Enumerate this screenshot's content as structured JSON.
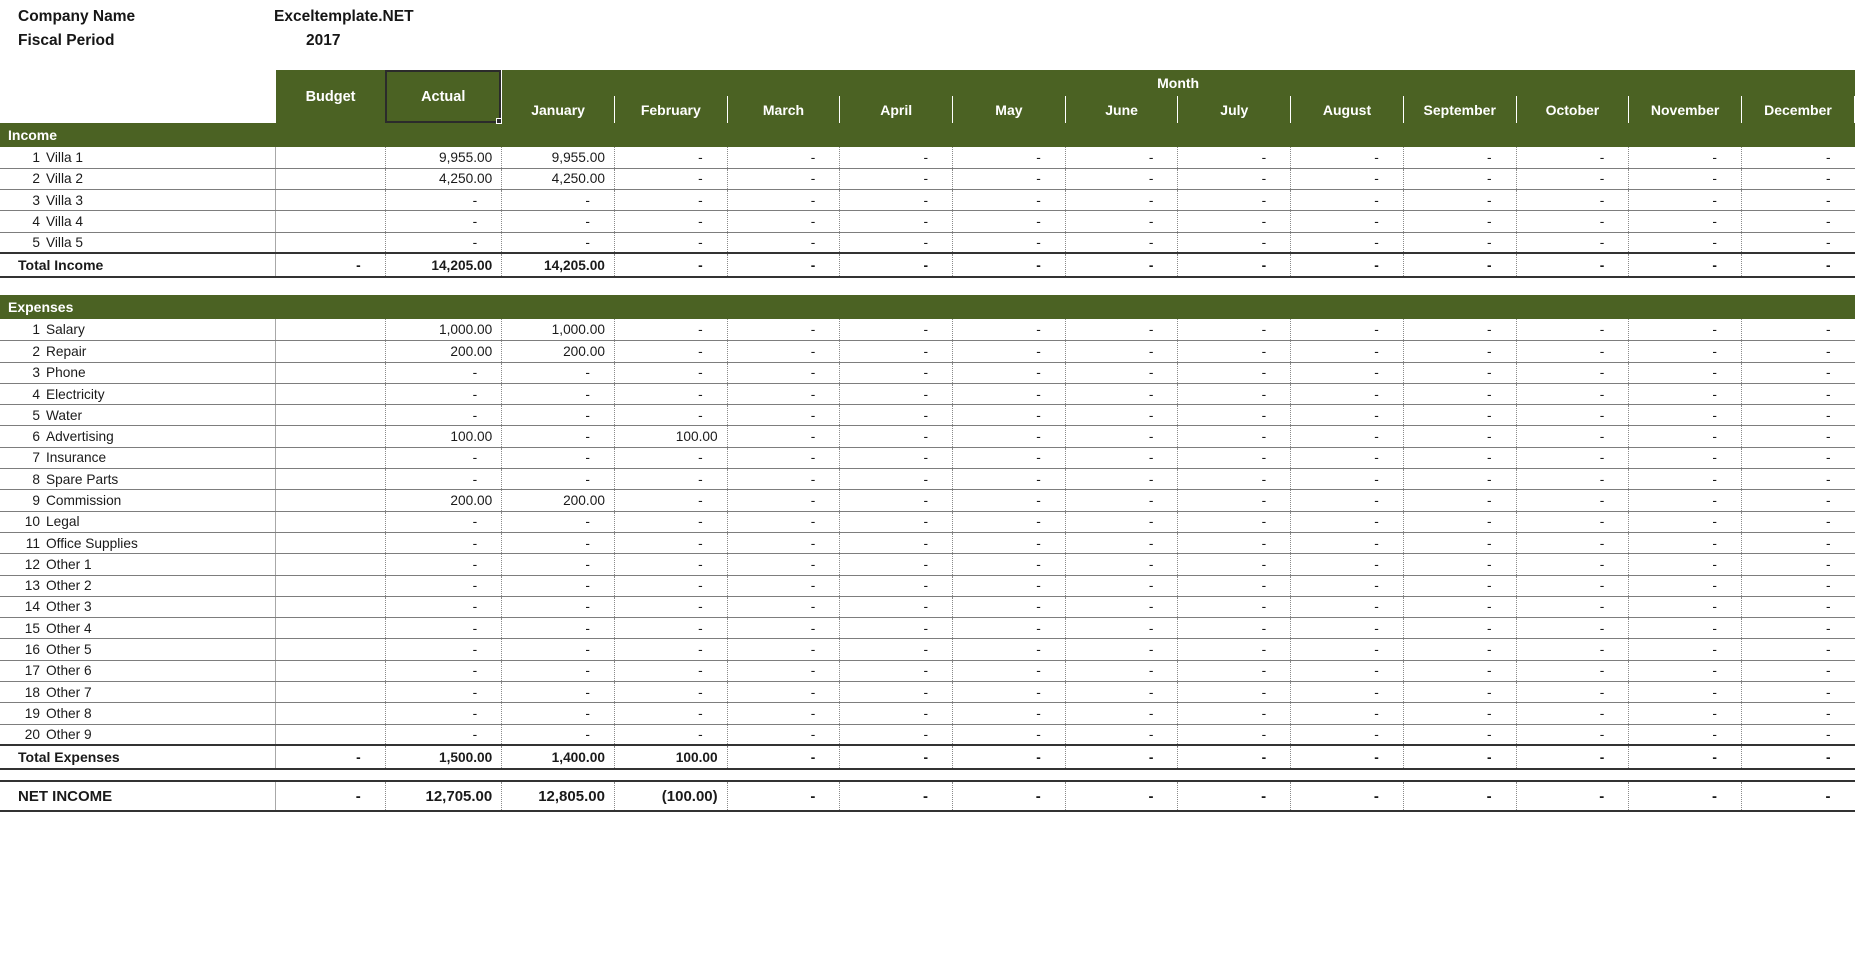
{
  "meta": {
    "company_label": "Company Name",
    "company_value": "Exceltemplate.NET",
    "fiscal_label": "Fiscal Period",
    "fiscal_value": "2017"
  },
  "colors": {
    "header_green": "#4b6223",
    "grid_line": "#7d7d7d",
    "total_line": "#333333",
    "text": "#1a1a1a"
  },
  "header": {
    "budget": "Budget",
    "actual": "Actual",
    "month_group": "Month",
    "months": [
      "January",
      "February",
      "March",
      "April",
      "May",
      "June",
      "July",
      "August",
      "September",
      "October",
      "November",
      "December"
    ]
  },
  "sections": {
    "income": {
      "title": "Income",
      "rows": [
        {
          "num": "1",
          "label": "Villa 1",
          "budget": "",
          "actual": "9,955.00",
          "months": [
            "9,955.00",
            "-",
            "-",
            "-",
            "-",
            "-",
            "-",
            "-",
            "-",
            "-",
            "-",
            "-"
          ]
        },
        {
          "num": "2",
          "label": "Villa 2",
          "budget": "",
          "actual": "4,250.00",
          "months": [
            "4,250.00",
            "-",
            "-",
            "-",
            "-",
            "-",
            "-",
            "-",
            "-",
            "-",
            "-",
            "-"
          ]
        },
        {
          "num": "3",
          "label": "Villa 3",
          "budget": "",
          "actual": "-",
          "months": [
            "-",
            "-",
            "-",
            "-",
            "-",
            "-",
            "-",
            "-",
            "-",
            "-",
            "-",
            "-"
          ]
        },
        {
          "num": "4",
          "label": "Villa 4",
          "budget": "",
          "actual": "-",
          "months": [
            "-",
            "-",
            "-",
            "-",
            "-",
            "-",
            "-",
            "-",
            "-",
            "-",
            "-",
            "-"
          ]
        },
        {
          "num": "5",
          "label": "Villa 5",
          "budget": "",
          "actual": "-",
          "months": [
            "-",
            "-",
            "-",
            "-",
            "-",
            "-",
            "-",
            "-",
            "-",
            "-",
            "-",
            "-"
          ]
        }
      ],
      "total": {
        "label": "Total Income",
        "budget": "-",
        "actual": "14,205.00",
        "months": [
          "14,205.00",
          "-",
          "-",
          "-",
          "-",
          "-",
          "-",
          "-",
          "-",
          "-",
          "-",
          "-"
        ]
      }
    },
    "expenses": {
      "title": "Expenses",
      "rows": [
        {
          "num": "1",
          "label": "Salary",
          "budget": "",
          "actual": "1,000.00",
          "months": [
            "1,000.00",
            "-",
            "-",
            "-",
            "-",
            "-",
            "-",
            "-",
            "-",
            "-",
            "-",
            "-"
          ]
        },
        {
          "num": "2",
          "label": "Repair",
          "budget": "",
          "actual": "200.00",
          "months": [
            "200.00",
            "-",
            "-",
            "-",
            "-",
            "-",
            "-",
            "-",
            "-",
            "-",
            "-",
            "-"
          ]
        },
        {
          "num": "3",
          "label": "Phone",
          "budget": "",
          "actual": "-",
          "months": [
            "-",
            "-",
            "-",
            "-",
            "-",
            "-",
            "-",
            "-",
            "-",
            "-",
            "-",
            "-"
          ]
        },
        {
          "num": "4",
          "label": "Electricity",
          "budget": "",
          "actual": "-",
          "months": [
            "-",
            "-",
            "-",
            "-",
            "-",
            "-",
            "-",
            "-",
            "-",
            "-",
            "-",
            "-"
          ]
        },
        {
          "num": "5",
          "label": "Water",
          "budget": "",
          "actual": "-",
          "months": [
            "-",
            "-",
            "-",
            "-",
            "-",
            "-",
            "-",
            "-",
            "-",
            "-",
            "-",
            "-"
          ]
        },
        {
          "num": "6",
          "label": "Advertising",
          "budget": "",
          "actual": "100.00",
          "months": [
            "-",
            "100.00",
            "-",
            "-",
            "-",
            "-",
            "-",
            "-",
            "-",
            "-",
            "-",
            "-"
          ]
        },
        {
          "num": "7",
          "label": "Insurance",
          "budget": "",
          "actual": "-",
          "months": [
            "-",
            "-",
            "-",
            "-",
            "-",
            "-",
            "-",
            "-",
            "-",
            "-",
            "-",
            "-"
          ]
        },
        {
          "num": "8",
          "label": "Spare Parts",
          "budget": "",
          "actual": "-",
          "months": [
            "-",
            "-",
            "-",
            "-",
            "-",
            "-",
            "-",
            "-",
            "-",
            "-",
            "-",
            "-"
          ]
        },
        {
          "num": "9",
          "label": "Commission",
          "budget": "",
          "actual": "200.00",
          "months": [
            "200.00",
            "-",
            "-",
            "-",
            "-",
            "-",
            "-",
            "-",
            "-",
            "-",
            "-",
            "-"
          ]
        },
        {
          "num": "10",
          "label": "Legal",
          "budget": "",
          "actual": "-",
          "months": [
            "-",
            "-",
            "-",
            "-",
            "-",
            "-",
            "-",
            "-",
            "-",
            "-",
            "-",
            "-"
          ]
        },
        {
          "num": "11",
          "label": "Office Supplies",
          "budget": "",
          "actual": "-",
          "months": [
            "-",
            "-",
            "-",
            "-",
            "-",
            "-",
            "-",
            "-",
            "-",
            "-",
            "-",
            "-"
          ]
        },
        {
          "num": "12",
          "label": "Other 1",
          "budget": "",
          "actual": "-",
          "months": [
            "-",
            "-",
            "-",
            "-",
            "-",
            "-",
            "-",
            "-",
            "-",
            "-",
            "-",
            "-"
          ]
        },
        {
          "num": "13",
          "label": "Other 2",
          "budget": "",
          "actual": "-",
          "months": [
            "-",
            "-",
            "-",
            "-",
            "-",
            "-",
            "-",
            "-",
            "-",
            "-",
            "-",
            "-"
          ]
        },
        {
          "num": "14",
          "label": "Other 3",
          "budget": "",
          "actual": "-",
          "months": [
            "-",
            "-",
            "-",
            "-",
            "-",
            "-",
            "-",
            "-",
            "-",
            "-",
            "-",
            "-"
          ]
        },
        {
          "num": "15",
          "label": "Other 4",
          "budget": "",
          "actual": "-",
          "months": [
            "-",
            "-",
            "-",
            "-",
            "-",
            "-",
            "-",
            "-",
            "-",
            "-",
            "-",
            "-"
          ]
        },
        {
          "num": "16",
          "label": "Other 5",
          "budget": "",
          "actual": "-",
          "months": [
            "-",
            "-",
            "-",
            "-",
            "-",
            "-",
            "-",
            "-",
            "-",
            "-",
            "-",
            "-"
          ]
        },
        {
          "num": "17",
          "label": "Other 6",
          "budget": "",
          "actual": "-",
          "months": [
            "-",
            "-",
            "-",
            "-",
            "-",
            "-",
            "-",
            "-",
            "-",
            "-",
            "-",
            "-"
          ]
        },
        {
          "num": "18",
          "label": "Other 7",
          "budget": "",
          "actual": "-",
          "months": [
            "-",
            "-",
            "-",
            "-",
            "-",
            "-",
            "-",
            "-",
            "-",
            "-",
            "-",
            "-"
          ]
        },
        {
          "num": "19",
          "label": "Other 8",
          "budget": "",
          "actual": "-",
          "months": [
            "-",
            "-",
            "-",
            "-",
            "-",
            "-",
            "-",
            "-",
            "-",
            "-",
            "-",
            "-"
          ]
        },
        {
          "num": "20",
          "label": "Other 9",
          "budget": "",
          "actual": "-",
          "months": [
            "-",
            "-",
            "-",
            "-",
            "-",
            "-",
            "-",
            "-",
            "-",
            "-",
            "-",
            "-"
          ]
        }
      ],
      "total": {
        "label": "Total Expenses",
        "budget": "-",
        "actual": "1,500.00",
        "months": [
          "1,400.00",
          "100.00",
          "-",
          "-",
          "-",
          "-",
          "-",
          "-",
          "-",
          "-",
          "-",
          "-"
        ]
      }
    }
  },
  "net_income": {
    "label": "NET INCOME",
    "budget": "-",
    "actual": "12,705.00",
    "months": [
      "12,805.00",
      "(100.00)",
      "-",
      "-",
      "-",
      "-",
      "-",
      "-",
      "-",
      "-",
      "-",
      "-"
    ]
  }
}
